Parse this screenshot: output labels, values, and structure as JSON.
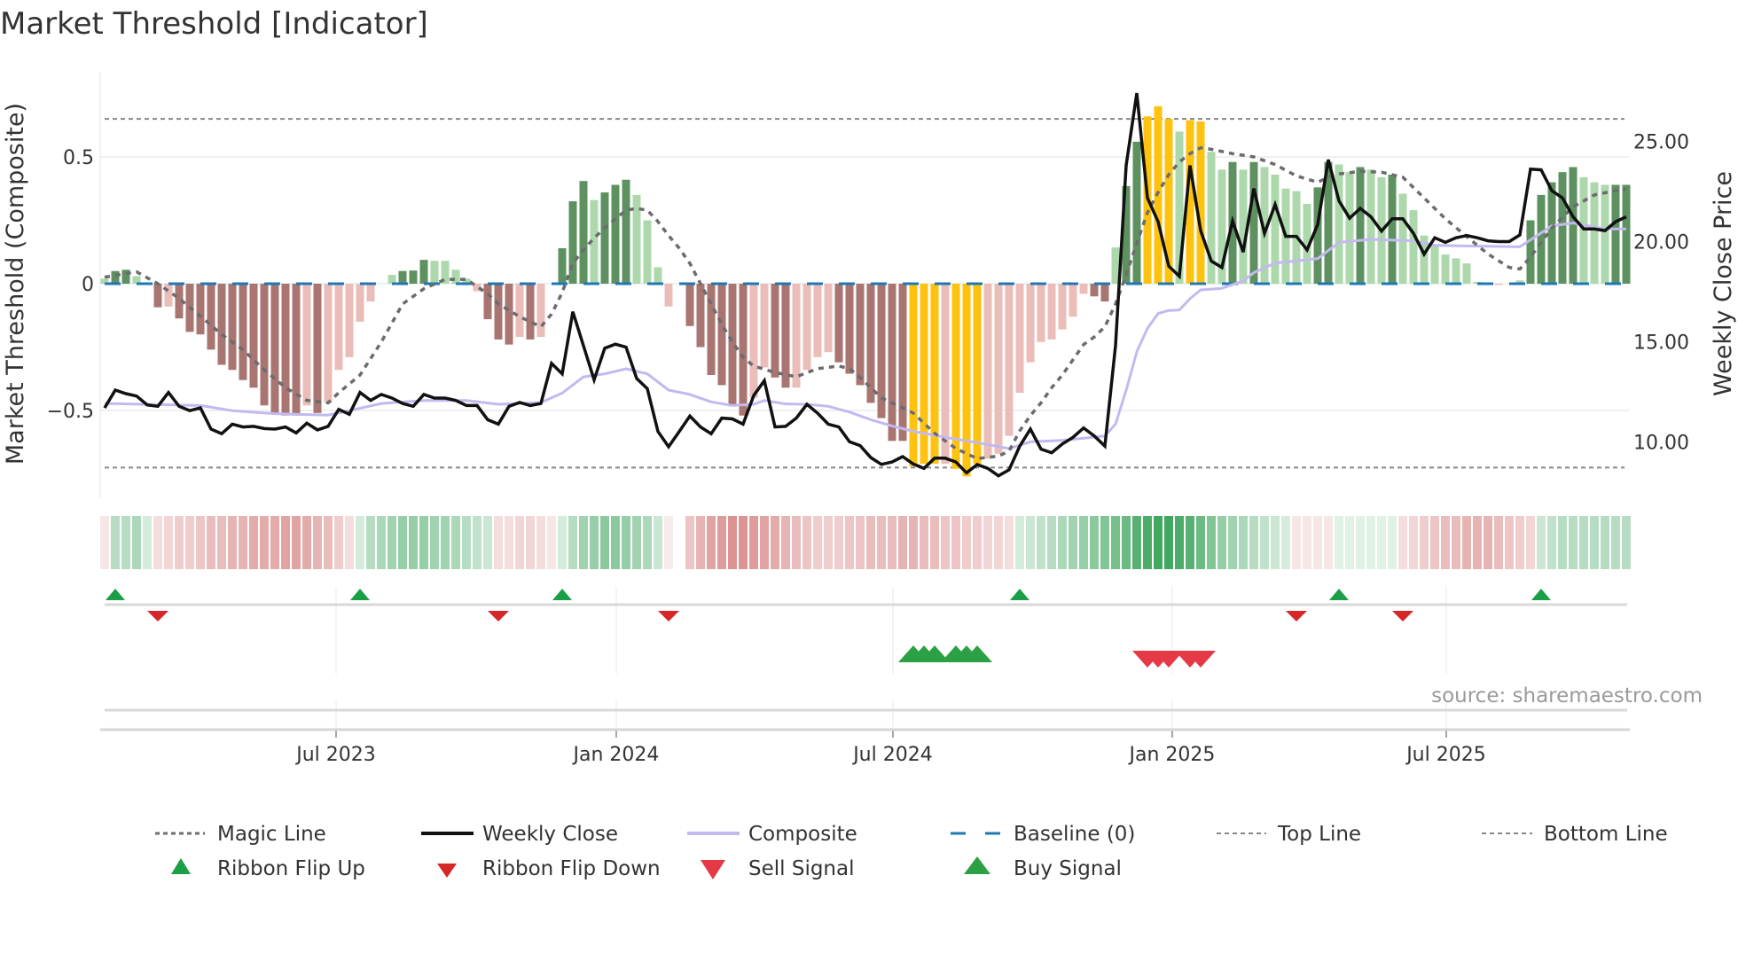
{
  "chart_data": {
    "type": "bar",
    "title": "Market Threshold [Indicator]",
    "source": "source: sharemaestro.com",
    "weeks": 144,
    "y_left": {
      "label": "Market Threshold (Composite)",
      "range": [
        -0.85,
        0.83
      ],
      "ticks": [
        {
          "value": 0.5,
          "label": "0.5"
        },
        {
          "value": 0,
          "label": "0"
        },
        {
          "value": -0.5,
          "label": "−0.5"
        }
      ],
      "top_line": 0.65,
      "bottom_line": -0.725
    },
    "y_right": {
      "label": "Weekly Close Price",
      "ticks": [
        {
          "value": 25,
          "label": "25.00"
        },
        {
          "value": 20,
          "label": "20.00"
        },
        {
          "value": 15,
          "label": "15.00"
        },
        {
          "value": 10,
          "label": "10.00"
        }
      ]
    },
    "x_ticks": [
      {
        "week": 22.75,
        "label": "Jul 2023"
      },
      {
        "week": 49.08,
        "label": "Jan 2024"
      },
      {
        "week": 75.08,
        "label": "Jul 2024"
      },
      {
        "week": 101.33,
        "label": "Jan 2025"
      },
      {
        "week": 127.08,
        "label": "Jul 2025"
      }
    ],
    "colors": {
      "dg": "#5e9160",
      "lg": "#acd8ab",
      "dr": "#a87570",
      "lr": "#ebbdb8",
      "y": "#ffc20e",
      "close": "#111111",
      "composite": "#c3b9f0",
      "magic": "#6b6b70",
      "baseline": "#1f77b4",
      "ribbon_green": "#2e9e4f",
      "ribbon_red": "#c85a57",
      "flip_up": "#1a9e46",
      "flip_down": "#d62728",
      "buy": "#2ca044",
      "sell": "#e63946"
    },
    "composite_bars": [
      0.02,
      0.05,
      0.055,
      0.03,
      0,
      -0.093,
      -0.09,
      -0.137,
      -0.19,
      -0.2,
      -0.26,
      -0.32,
      -0.34,
      -0.38,
      -0.41,
      -0.48,
      -0.51,
      -0.52,
      -0.52,
      -0.48,
      -0.51,
      -0.47,
      -0.34,
      -0.29,
      -0.15,
      -0.07,
      0,
      0.035,
      0.05,
      0.052,
      0.094,
      0.09,
      0.09,
      0.055,
      0.02,
      -0.03,
      -0.14,
      -0.22,
      -0.24,
      -0.21,
      -0.22,
      -0.21,
      0,
      0.14,
      0.325,
      0.405,
      0.33,
      0.36,
      0.39,
      0.41,
      0.35,
      0.25,
      0.065,
      -0.09,
      0,
      -0.167,
      -0.25,
      -0.36,
      -0.4,
      -0.48,
      -0.52,
      -0.45,
      -0.33,
      -0.37,
      -0.41,
      -0.41,
      -0.34,
      -0.29,
      -0.27,
      -0.31,
      -0.355,
      -0.4,
      -0.47,
      -0.53,
      -0.62,
      -0.62,
      -0.72,
      -0.71,
      -0.71,
      -0.71,
      -0.73,
      -0.76,
      -0.71,
      -0.69,
      -0.67,
      -0.6,
      -0.43,
      -0.31,
      -0.23,
      -0.22,
      -0.18,
      -0.13,
      -0.04,
      -0.05,
      -0.07,
      0.143,
      0.385,
      0.56,
      0.66,
      0.7,
      0.65,
      0.6,
      0.645,
      0.64,
      0.52,
      0.45,
      0.48,
      0.45,
      0.48,
      0.46,
      0.43,
      0.375,
      0.365,
      0.315,
      0.38,
      0.48,
      0.47,
      0.44,
      0.46,
      0.45,
      0.42,
      0.43,
      0.355,
      0.29,
      0.19,
      0.15,
      0.115,
      0.1,
      0.08,
      0.007,
      0,
      -0.005,
      0,
      0.013,
      0.25,
      0.35,
      0.4,
      0.44,
      0.46,
      0.42,
      0.4,
      0.39,
      0.39,
      0.39
    ],
    "bar_colors": [
      "lg",
      "dg",
      "dg",
      "lg",
      "lr",
      "dr",
      "lr",
      "dr",
      "dr",
      "dr",
      "dr",
      "dr",
      "dr",
      "dr",
      "dr",
      "dr",
      "dr",
      "dr",
      "dr",
      "lr",
      "dr",
      "lr",
      "lr",
      "lr",
      "lr",
      "lr",
      "lr",
      "lg",
      "dg",
      "dg",
      "dg",
      "lg",
      "lg",
      "lg",
      "lg",
      "lr",
      "dr",
      "dr",
      "dr",
      "lr",
      "dr",
      "lr",
      "lg",
      "dg",
      "dg",
      "dg",
      "lg",
      "dg",
      "dg",
      "dg",
      "lg",
      "lg",
      "lg",
      "lr",
      "lr",
      "dr",
      "dr",
      "dr",
      "dr",
      "dr",
      "dr",
      "lr",
      "lr",
      "dr",
      "dr",
      "lr",
      "lr",
      "lr",
      "lr",
      "dr",
      "dr",
      "dr",
      "dr",
      "dr",
      "dr",
      "dr",
      "y",
      "y",
      "y",
      "lr",
      "y",
      "y",
      "y",
      "lr",
      "lr",
      "lr",
      "lr",
      "lr",
      "lr",
      "lr",
      "lr",
      "lr",
      "lr",
      "dr",
      "dr",
      "lg",
      "dg",
      "dg",
      "y",
      "y",
      "y",
      "lg",
      "y",
      "y",
      "lg",
      "lg",
      "dg",
      "lg",
      "dg",
      "lg",
      "lg",
      "lg",
      "lg",
      "lg",
      "dg",
      "dg",
      "lg",
      "lg",
      "dg",
      "lg",
      "lg",
      "dg",
      "lg",
      "lg",
      "lg",
      "lg",
      "lg",
      "lg",
      "lg",
      "lg",
      "lg",
      "lr",
      "lg",
      "lg",
      "dg",
      "dg",
      "dg",
      "dg",
      "dg",
      "lg",
      "lg",
      "lg",
      "dg",
      "dg"
    ],
    "weekly_close": [
      11.7,
      12.59,
      12.41,
      12.29,
      11.85,
      11.78,
      12.47,
      11.78,
      11.56,
      11.7,
      10.64,
      10.41,
      10.89,
      10.75,
      10.78,
      10.67,
      10.64,
      10.75,
      10.45,
      10.94,
      10.6,
      10.78,
      11.63,
      11.38,
      12.47,
      12.07,
      12.37,
      12.19,
      11.92,
      11.78,
      12.37,
      12.19,
      12.19,
      12.07,
      11.82,
      11.82,
      11.11,
      10.89,
      11.78,
      11.97,
      11.82,
      11.92,
      13.92,
      13.4,
      16.5,
      14.8,
      13.1,
      14.68,
      14.88,
      14.73,
      13.17,
      12.66,
      10.52,
      9.76,
      10.52,
      11.29,
      10.75,
      10.41,
      11.19,
      11.15,
      10.89,
      12.32,
      13.06,
      10.75,
      10.78,
      11.19,
      11.88,
      11.44,
      10.89,
      10.75,
      10.01,
      9.82,
      9.22,
      8.88,
      9.0,
      9.27,
      8.9,
      8.68,
      9.19,
      9.19,
      9.0,
      8.46,
      8.87,
      8.68,
      8.31,
      8.61,
      9.79,
      10.64,
      9.64,
      9.46,
      9.9,
      10.23,
      10.7,
      10.3,
      9.79,
      14.8,
      23.8,
      27.41,
      22.18,
      21.0,
      18.78,
      18.27,
      23.8,
      20.55,
      19.03,
      18.71,
      21.03,
      19.48,
      22.65,
      20.41,
      21.85,
      20.26,
      20.26,
      19.59,
      20.85,
      24.09,
      22.03,
      21.17,
      21.66,
      21.24,
      20.52,
      21.14,
      21.14,
      20.41,
      19.37,
      20.19,
      19.96,
      20.19,
      20.3,
      20.19,
      20.04,
      20.0,
      20.0,
      20.33,
      23.62,
      23.58,
      22.54,
      22.18,
      21.24,
      20.63,
      20.63,
      20.55,
      20.99,
      21.24
    ],
    "magic_line": [
      [
        1,
        0.026
      ],
      [
        4,
        0.047
      ],
      [
        6,
        0
      ],
      [
        8,
        -0.058
      ],
      [
        10,
        -0.128
      ],
      [
        12,
        -0.2
      ],
      [
        14,
        -0.26
      ],
      [
        16,
        -0.34
      ],
      [
        18,
        -0.41
      ],
      [
        20,
        -0.46
      ],
      [
        22,
        -0.47
      ],
      [
        23,
        -0.43
      ],
      [
        25,
        -0.36
      ],
      [
        27,
        -0.23
      ],
      [
        29,
        -0.08
      ],
      [
        31,
        -0.02
      ],
      [
        33,
        0.017
      ],
      [
        35,
        0.017
      ],
      [
        37,
        -0.04
      ],
      [
        38,
        -0.08
      ],
      [
        40,
        -0.13
      ],
      [
        42,
        -0.17
      ],
      [
        43,
        -0.12
      ],
      [
        44,
        -0.035
      ],
      [
        45,
        0.08
      ],
      [
        46,
        0.134
      ],
      [
        47,
        0.18
      ],
      [
        48,
        0.22
      ],
      [
        49,
        0.256
      ],
      [
        50,
        0.29
      ],
      [
        51,
        0.297
      ],
      [
        52,
        0.29
      ],
      [
        53,
        0.245
      ],
      [
        54,
        0.19
      ],
      [
        55,
        0.14
      ],
      [
        56,
        0.08
      ],
      [
        57,
        0
      ],
      [
        58,
        -0.08
      ],
      [
        59,
        -0.16
      ],
      [
        60,
        -0.23
      ],
      [
        61,
        -0.29
      ],
      [
        62,
        -0.325
      ],
      [
        64,
        -0.35
      ],
      [
        66,
        -0.367
      ],
      [
        68,
        -0.335
      ],
      [
        70,
        -0.325
      ],
      [
        71,
        -0.335
      ],
      [
        72,
        -0.37
      ],
      [
        73,
        -0.41
      ],
      [
        74,
        -0.45
      ],
      [
        75,
        -0.47
      ],
      [
        77,
        -0.51
      ],
      [
        79,
        -0.59
      ],
      [
        81,
        -0.65
      ],
      [
        83,
        -0.69
      ],
      [
        85,
        -0.68
      ],
      [
        86,
        -0.66
      ],
      [
        87,
        -0.58
      ],
      [
        88,
        -0.52
      ],
      [
        89,
        -0.47
      ],
      [
        90,
        -0.41
      ],
      [
        91,
        -0.36
      ],
      [
        92,
        -0.3
      ],
      [
        93,
        -0.24
      ],
      [
        94,
        -0.21
      ],
      [
        95,
        -0.17
      ],
      [
        96,
        -0.08
      ],
      [
        97,
        0.035
      ],
      [
        98,
        0.16
      ],
      [
        99,
        0.28
      ],
      [
        100,
        0.36
      ],
      [
        101,
        0.43
      ],
      [
        102,
        0.48
      ],
      [
        103,
        0.513
      ],
      [
        104,
        0.536
      ],
      [
        105,
        0.53
      ],
      [
        107,
        0.513
      ],
      [
        109,
        0.5
      ],
      [
        111,
        0.47
      ],
      [
        113,
        0.425
      ],
      [
        115,
        0.4
      ],
      [
        116,
        0.42
      ],
      [
        117,
        0.433
      ],
      [
        119,
        0.443
      ],
      [
        121,
        0.44
      ],
      [
        123,
        0.42
      ],
      [
        125,
        0.338
      ],
      [
        127,
        0.256
      ],
      [
        129,
        0.186
      ],
      [
        131,
        0.117
      ],
      [
        133,
        0.064
      ],
      [
        134,
        0.058
      ],
      [
        135,
        0.105
      ],
      [
        137,
        0.22
      ],
      [
        139,
        0.303
      ],
      [
        141,
        0.35
      ],
      [
        143,
        0.367
      ],
      [
        144,
        0.373
      ]
    ],
    "composite_line": [
      [
        1,
        11.92
      ],
      [
        10,
        11.82
      ],
      [
        13,
        11.56
      ],
      [
        17,
        11.41
      ],
      [
        22,
        11.34
      ],
      [
        24,
        11.56
      ],
      [
        27,
        11.92
      ],
      [
        31,
        12.07
      ],
      [
        35,
        12.07
      ],
      [
        38,
        11.88
      ],
      [
        42,
        11.97
      ],
      [
        44,
        12.44
      ],
      [
        46,
        13.25
      ],
      [
        48,
        13.4
      ],
      [
        50,
        13.65
      ],
      [
        52,
        13.4
      ],
      [
        54,
        12.59
      ],
      [
        56,
        12.37
      ],
      [
        58,
        12.0
      ],
      [
        60,
        11.82
      ],
      [
        62,
        11.88
      ],
      [
        63,
        12.07
      ],
      [
        65,
        11.9
      ],
      [
        67,
        11.88
      ],
      [
        69,
        11.78
      ],
      [
        71,
        11.49
      ],
      [
        73,
        11.11
      ],
      [
        75,
        10.8
      ],
      [
        77,
        10.53
      ],
      [
        80,
        10.23
      ],
      [
        83,
        9.97
      ],
      [
        86,
        9.67
      ],
      [
        88,
        10.01
      ],
      [
        91,
        10.08
      ],
      [
        95,
        10.3
      ],
      [
        96,
        10.89
      ],
      [
        97,
        12.58
      ],
      [
        98,
        14.5
      ],
      [
        99,
        15.67
      ],
      [
        100,
        16.41
      ],
      [
        101,
        16.56
      ],
      [
        102,
        16.59
      ],
      [
        103,
        17.15
      ],
      [
        104,
        17.59
      ],
      [
        106,
        17.67
      ],
      [
        108,
        18.04
      ],
      [
        109,
        18.45
      ],
      [
        111,
        18.93
      ],
      [
        113,
        19.04
      ],
      [
        115,
        19.15
      ],
      [
        117,
        19.96
      ],
      [
        120,
        20.11
      ],
      [
        124,
        20.04
      ],
      [
        126,
        19.81
      ],
      [
        134,
        19.74
      ],
      [
        137,
        20.78
      ],
      [
        139,
        20.93
      ],
      [
        142,
        20.63
      ],
      [
        144,
        20.63
      ]
    ],
    "ribbon": [
      -0.15,
      0.35,
      0.35,
      0.4,
      0.2,
      -0.2,
      -0.25,
      -0.3,
      -0.3,
      -0.35,
      -0.4,
      -0.4,
      -0.45,
      -0.45,
      -0.5,
      -0.5,
      -0.5,
      -0.55,
      -0.55,
      -0.5,
      -0.45,
      -0.4,
      -0.3,
      -0.2,
      0.2,
      0.35,
      0.4,
      0.45,
      0.5,
      0.5,
      0.5,
      0.45,
      0.45,
      0.4,
      0.35,
      0.3,
      0.25,
      -0.2,
      -0.2,
      -0.25,
      -0.25,
      -0.2,
      -0.15,
      0.2,
      0.35,
      0.45,
      0.5,
      0.55,
      0.55,
      0.5,
      0.45,
      0.4,
      0.25,
      -0.1,
      null,
      -0.35,
      -0.45,
      -0.55,
      -0.6,
      -0.65,
      -0.65,
      -0.6,
      -0.55,
      -0.5,
      -0.45,
      -0.4,
      -0.35,
      -0.3,
      -0.3,
      -0.3,
      -0.35,
      -0.35,
      -0.4,
      -0.4,
      -0.4,
      -0.45,
      -0.45,
      -0.4,
      -0.4,
      -0.35,
      -0.35,
      -0.3,
      -0.3,
      -0.25,
      -0.25,
      -0.2,
      0.2,
      0.25,
      0.3,
      0.35,
      0.4,
      0.45,
      0.5,
      0.55,
      0.6,
      0.65,
      0.7,
      0.8,
      0.85,
      0.9,
      0.9,
      0.85,
      0.8,
      0.7,
      0.6,
      0.5,
      0.45,
      0.4,
      0.35,
      0.3,
      0.25,
      0.2,
      -0.15,
      -0.15,
      -0.15,
      -0.15,
      0.15,
      0.15,
      0.15,
      0.15,
      0.15,
      0.15,
      -0.2,
      -0.25,
      -0.3,
      -0.35,
      -0.4,
      -0.4,
      -0.45,
      -0.45,
      -0.45,
      -0.4,
      -0.35,
      -0.3,
      -0.25,
      0.25,
      0.3,
      0.35,
      0.35,
      0.35,
      0.35,
      0.35,
      0.35,
      0.35
    ],
    "ribbon_flip_up": [
      2,
      25,
      44,
      87,
      117,
      136
    ],
    "ribbon_flip_down": [
      6,
      38,
      54,
      113,
      123
    ],
    "buy_signals": [
      77,
      78,
      79,
      81,
      82,
      83
    ],
    "sell_signals": [
      99,
      100,
      101,
      103,
      104
    ],
    "legend": {
      "magic": "Magic Line",
      "close": "Weekly Close",
      "composite": "Composite",
      "baseline": "Baseline (0)",
      "top": "Top Line",
      "bottom": "Bottom Line",
      "flip_up": "Ribbon Flip Up",
      "flip_down": "Ribbon Flip Down",
      "sell": "Sell Signal",
      "buy": "Buy Signal"
    }
  }
}
